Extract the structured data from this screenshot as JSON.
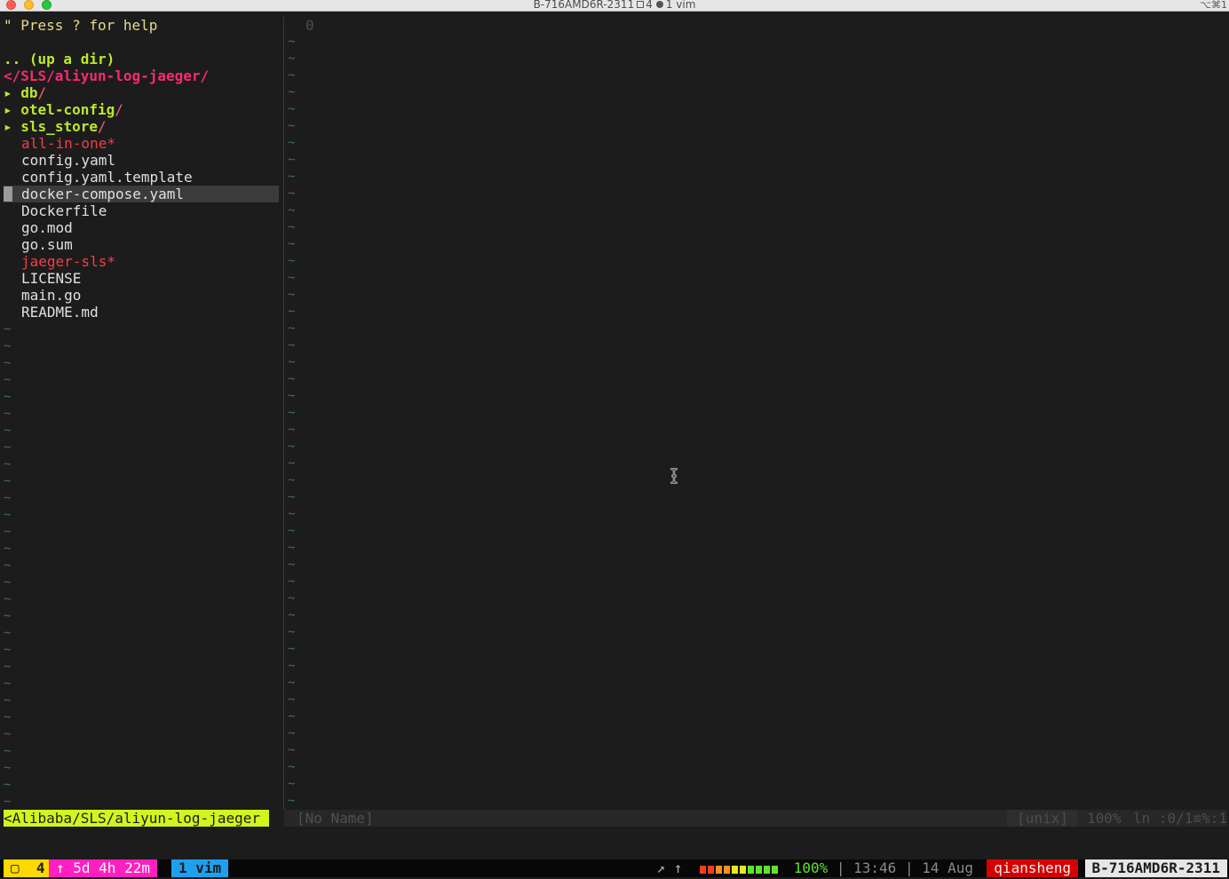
{
  "window": {
    "title_host": "B-716AMD6R-2311",
    "title_tab_count": "4",
    "title_pane": "1 vim",
    "shortcut": "⌥⌘1"
  },
  "tree": {
    "help": "\" Press ? for help",
    "updir": ".. (up a dir)",
    "current_dir": "</SLS/aliyun-log-jaeger/",
    "dirs": [
      {
        "arrow": "▸",
        "name": "db",
        "slash": "/"
      },
      {
        "arrow": "▸",
        "name": "otel-config",
        "slash": "/"
      },
      {
        "arrow": "▸",
        "name": "sls_store",
        "slash": "/"
      }
    ],
    "files": [
      {
        "name": "all-in-one*",
        "kind": "exec"
      },
      {
        "name": "config.yaml",
        "kind": "file"
      },
      {
        "name": "config.yaml.template",
        "kind": "file"
      },
      {
        "name": "docker-compose.yaml",
        "kind": "file",
        "selected": true
      },
      {
        "name": "Dockerfile",
        "kind": "file"
      },
      {
        "name": "go.mod",
        "kind": "file"
      },
      {
        "name": "go.sum",
        "kind": "file"
      },
      {
        "name": "jaeger-sls*",
        "kind": "exec"
      },
      {
        "name": "LICENSE",
        "kind": "file"
      },
      {
        "name": "main.go",
        "kind": "file"
      },
      {
        "name": "README.md",
        "kind": "file"
      }
    ],
    "tilde": "~"
  },
  "editor": {
    "line_number": "0"
  },
  "statusline": {
    "left_path": "<Alibaba/SLS/aliyun-log-jaeger",
    "buffer_name": "[No Name]",
    "fileformat": "[unix]",
    "percent": "100%",
    "position": "ln :0/1≡%:1"
  },
  "tmux": {
    "session": "▢  4",
    "uptime": "↑ 5d 4h 22m",
    "window": "1 vim",
    "arrows": "↗ ↑",
    "battery_pct": "100%",
    "battery_level": 1.0,
    "time": "| 13:46 | 14 Aug",
    "user": "qiansheng",
    "host": "B-716AMD6R-2311"
  },
  "colors": {
    "accent_lime": "#d2f51d",
    "dir_green": "#bde82c",
    "current_dir_pink": "#fa2a6e",
    "exec_red": "#f0404a",
    "tmux_pink": "#ff1fc0",
    "tmux_blue": "#1ea0ee",
    "tmux_yellow": "#ffd800",
    "tmux_red": "#d70000"
  }
}
